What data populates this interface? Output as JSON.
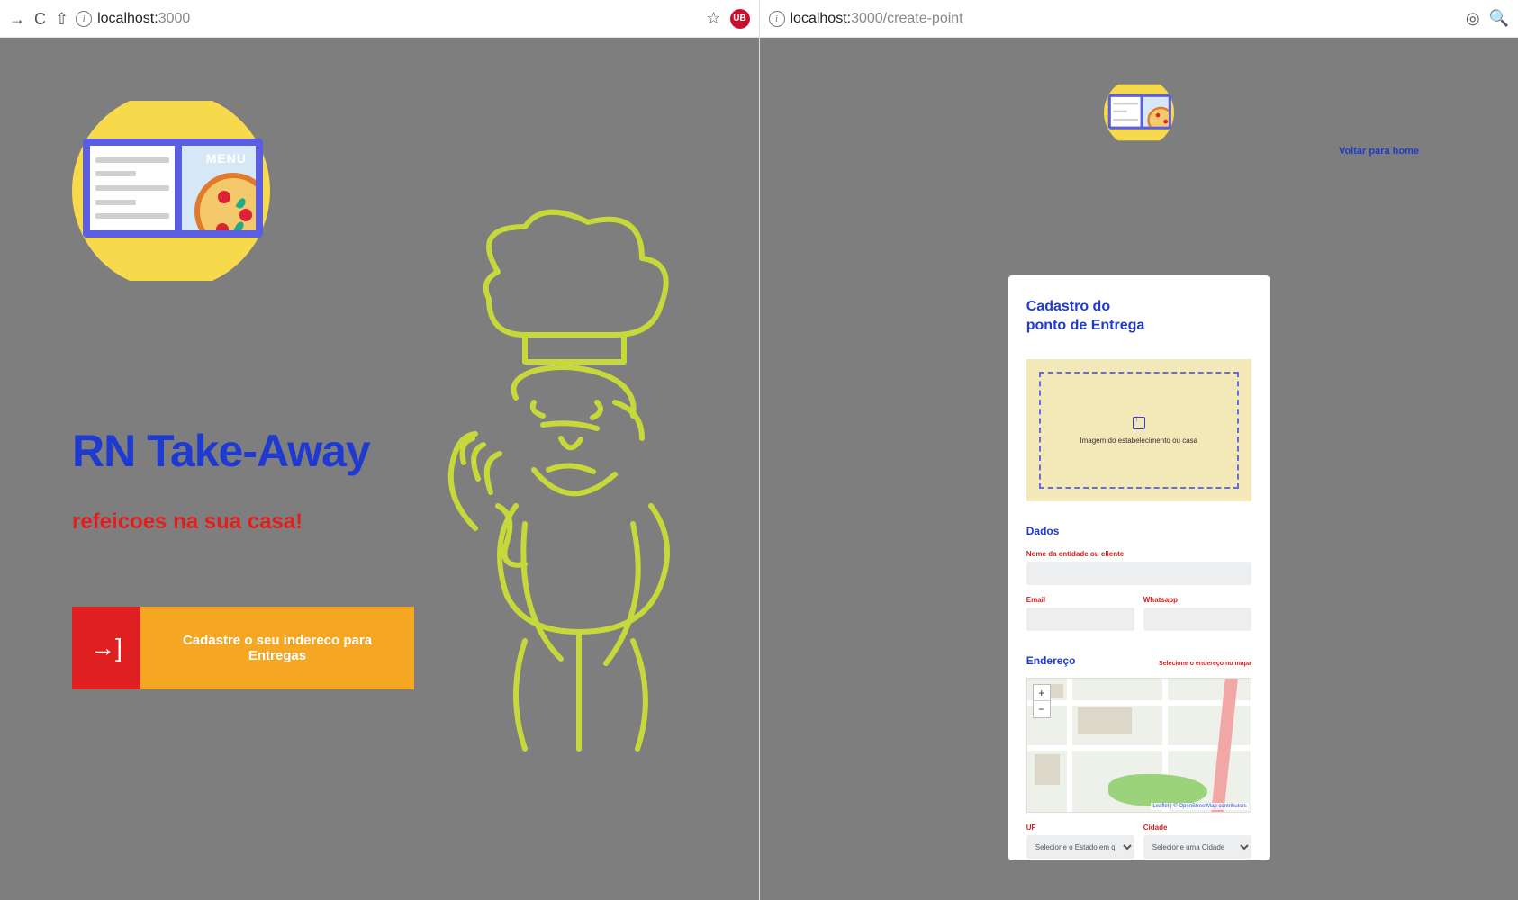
{
  "left": {
    "browser": {
      "url_host": "localhost:",
      "url_port": "3000",
      "url_path": "",
      "ublock_badge": "UB"
    },
    "logo": {
      "menu_label": "MENU"
    },
    "hero": {
      "title": "RN Take-Away",
      "subtitle": "refeicoes na sua casa!",
      "cta_label": "Cadastre o seu indereco para Entregas",
      "cta_icon_glyph": "→]"
    }
  },
  "right": {
    "browser": {
      "url_host": "localhost:",
      "url_port": "3000",
      "url_path": "/create-point"
    },
    "back_link": "Voltar para home",
    "form": {
      "title_line1": "Cadastro do",
      "title_line2": "ponto de Entrega",
      "dropzone_text": "Imagem do estabelecimento ou casa",
      "section_dados": "Dados",
      "fields": {
        "name_label": "Nome da entidade ou cliente",
        "email_label": "Email",
        "whatsapp_label": "Whatsapp"
      },
      "section_endereco": "Endereço",
      "endereco_hint": "Selecione o endereço no mapa",
      "map": {
        "zoom_in": "+",
        "zoom_out": "−",
        "attribution": "Leaflet | © OpenStreetMap contributors"
      },
      "selects": {
        "uf_label": "UF",
        "uf_placeholder": "Selecione o Estado em que reside",
        "city_label": "Cidade",
        "city_placeholder": "Selecione uma Cidade"
      }
    }
  }
}
